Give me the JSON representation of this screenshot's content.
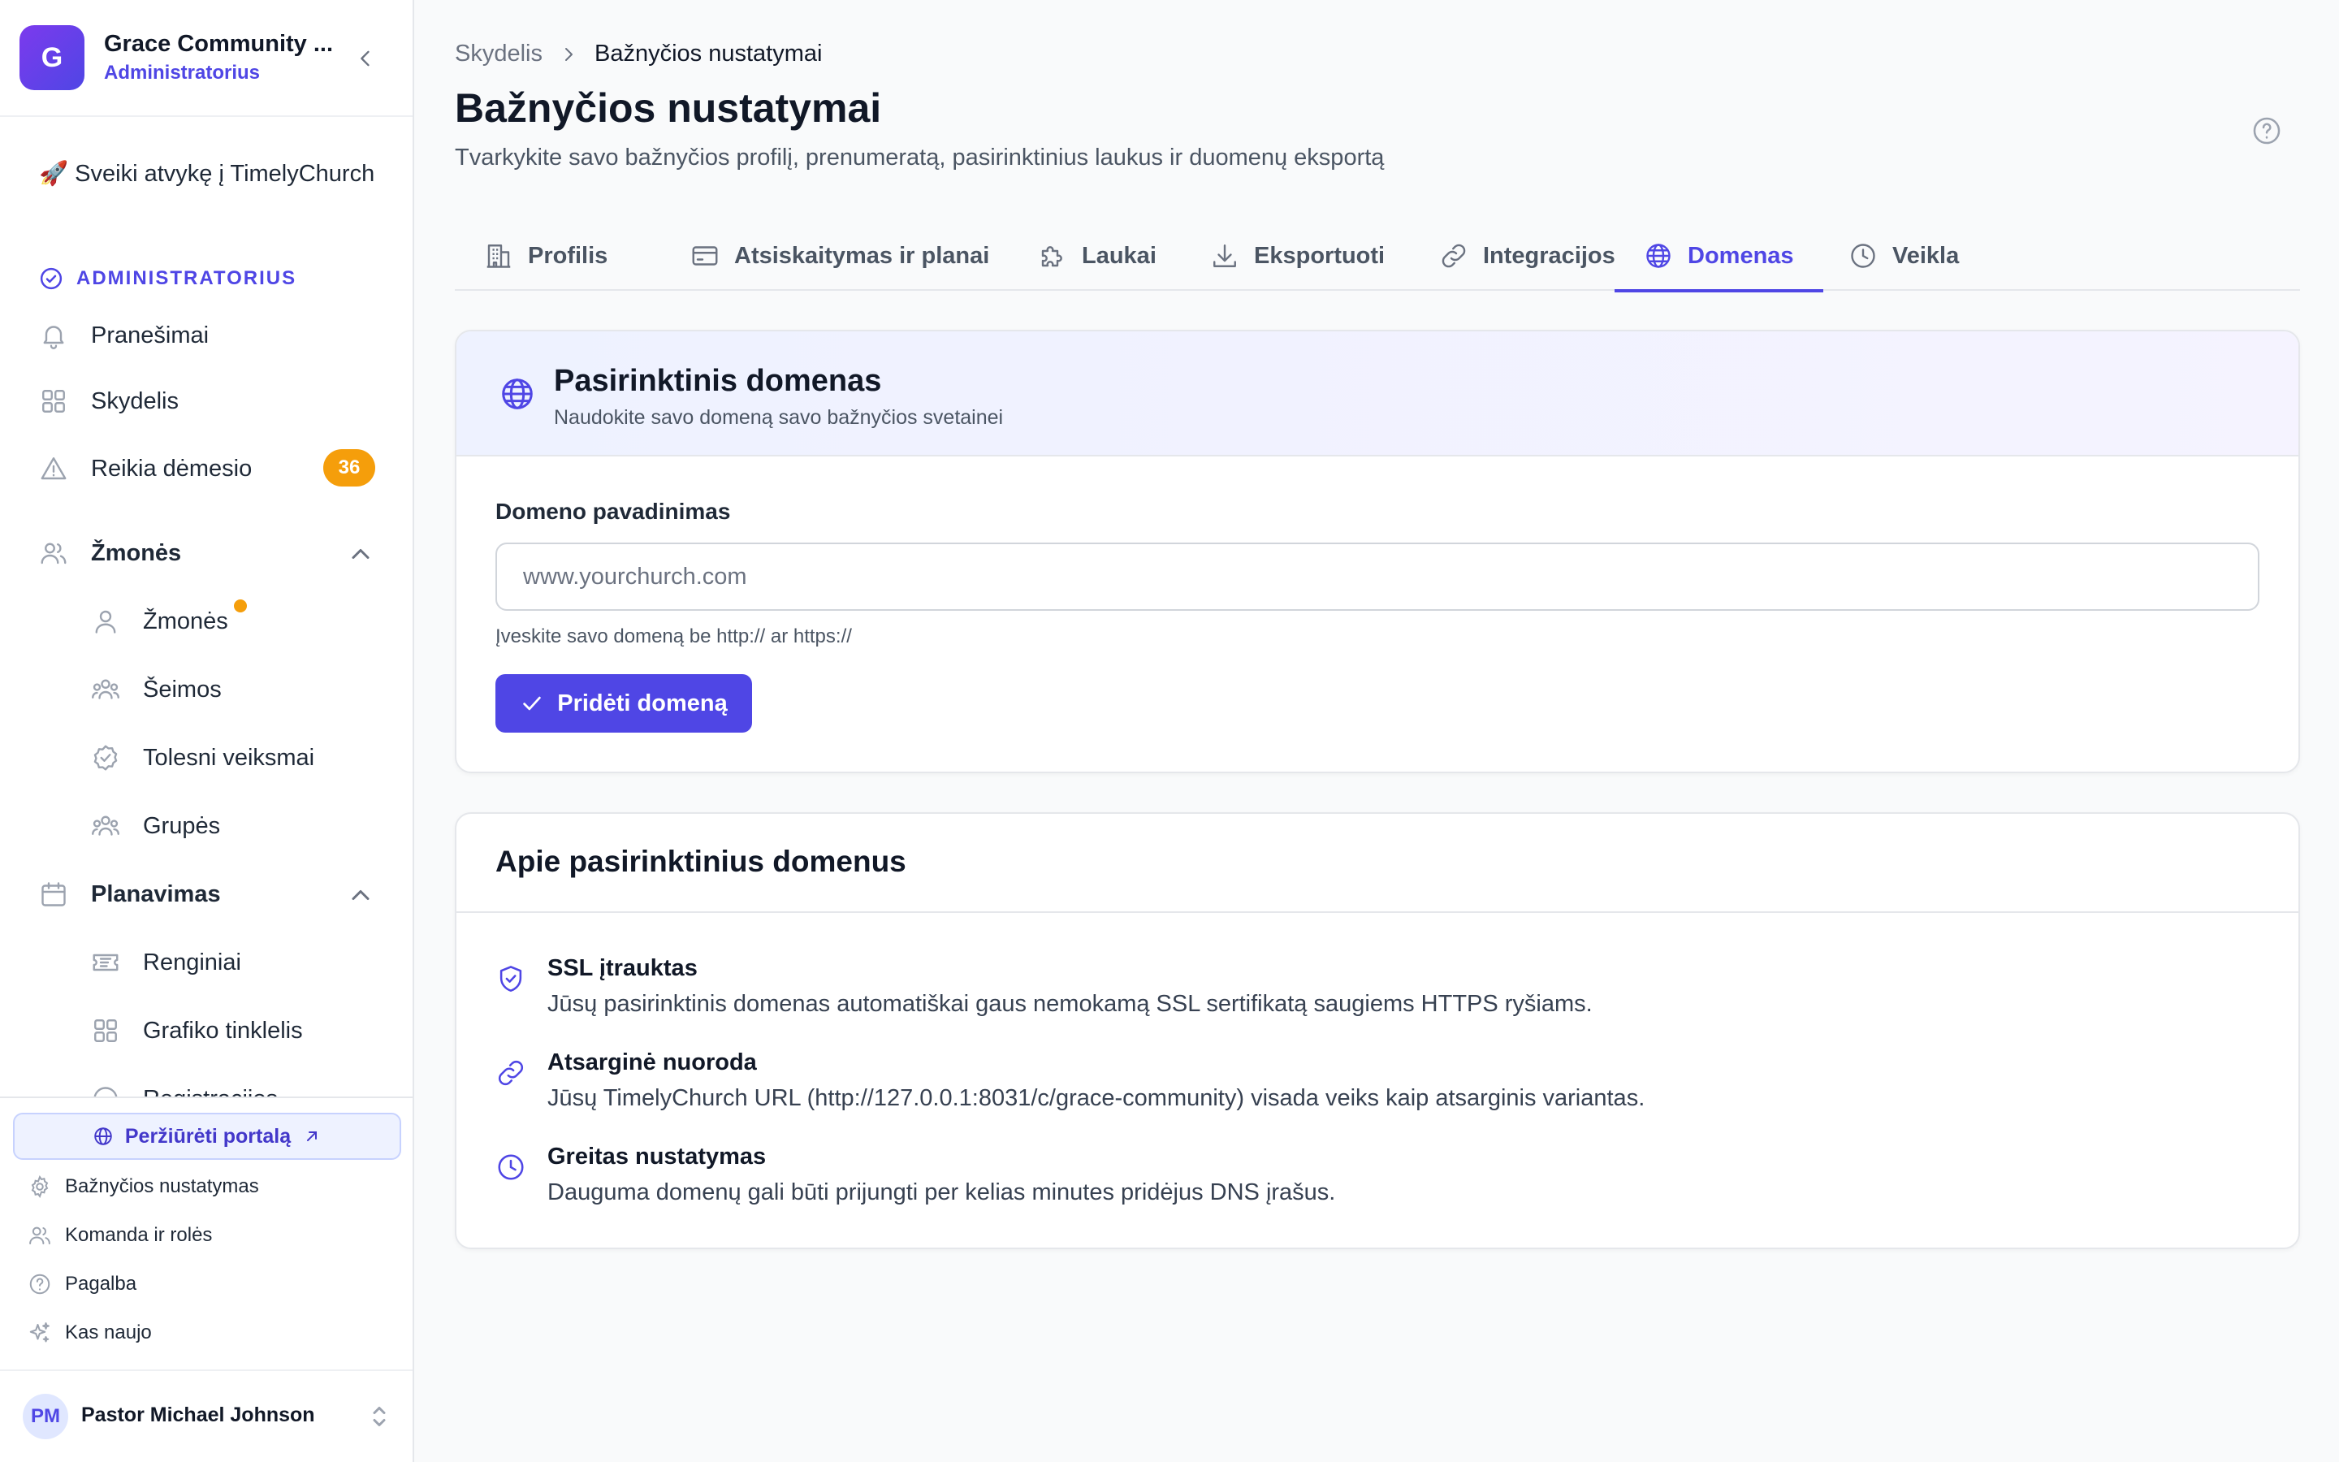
{
  "sidebar": {
    "org_initial": "G",
    "org_name": "Grace Community ...",
    "org_role": "Administratorius",
    "welcome": "🚀 Sveiki atvykę į TimelyChurch",
    "section_admin": "ADMINISTRATORIUS",
    "items": {
      "notifications": "Pranešimai",
      "dashboard": "Skydelis",
      "attention": "Reikia dėmesio",
      "attention_count": "36",
      "people_group": "Žmonės",
      "people": "Žmonės",
      "families": "Šeimos",
      "followups": "Tolesni veiksmai",
      "groups": "Grupės",
      "planning_group": "Planavimas",
      "events": "Renginiai",
      "schedule_grid": "Grafiko tinklelis",
      "registrations": "Registracijos"
    },
    "portal_button": "Peržiūrėti portalą",
    "footer": {
      "church_settings": "Bažnyčios nustatymas",
      "team_roles": "Komanda ir rolės",
      "help": "Pagalba",
      "whats_new": "Kas naujo"
    },
    "user": {
      "initials": "PM",
      "name": "Pastor Michael Johnson"
    }
  },
  "header": {
    "breadcrumb_root": "Skydelis",
    "breadcrumb_current": "Bažnyčios nustatymai",
    "title": "Bažnyčios nustatymai",
    "subtitle": "Tvarkykite savo bažnyčios profilį, prenumeratą, pasirinktinius laukus ir duomenų eksportą"
  },
  "tabs": [
    {
      "label": "Profilis",
      "icon": "building-icon"
    },
    {
      "label": "Atsiskaitymas ir planai",
      "icon": "credit-card-icon"
    },
    {
      "label": "Laukai",
      "icon": "puzzle-icon"
    },
    {
      "label": "Eksportuoti",
      "icon": "download-icon"
    },
    {
      "label": "Integracijos",
      "icon": "link-icon"
    },
    {
      "label": "Domenas",
      "icon": "globe-icon",
      "active": true
    },
    {
      "label": "Veikla",
      "icon": "clock-icon"
    }
  ],
  "domain_card": {
    "title": "Pasirinktinis domenas",
    "subtitle": "Naudokite savo domeną savo bažnyčios svetainei",
    "field_label": "Domeno pavadinimas",
    "placeholder": "www.yourchurch.com",
    "value": "",
    "hint": "Įveskite savo domeną be http:// ar https://",
    "button": "Pridėti domeną"
  },
  "about_card": {
    "title": "Apie pasirinktinius domenus",
    "items": [
      {
        "title": "SSL įtrauktas",
        "desc": "Jūsų pasirinktinis domenas automatiškai gaus nemokamą SSL sertifikatą saugiems HTTPS ryšiams.",
        "icon": "shield-check-icon"
      },
      {
        "title": "Atsarginė nuoroda",
        "desc": "Jūsų TimelyChurch URL (http://127.0.0.1:8031/c/grace-community) visada veiks kaip atsarginis variantas.",
        "icon": "link-icon"
      },
      {
        "title": "Greitas nustatymas",
        "desc": "Dauguma domenų gali būti prijungti per kelias minutes pridėjus DNS įrašus.",
        "icon": "clock-icon"
      }
    ]
  },
  "colors": {
    "accent": "#4f46e5",
    "badge": "#f59e0b",
    "text": "#111827",
    "muted": "#6b7280"
  }
}
